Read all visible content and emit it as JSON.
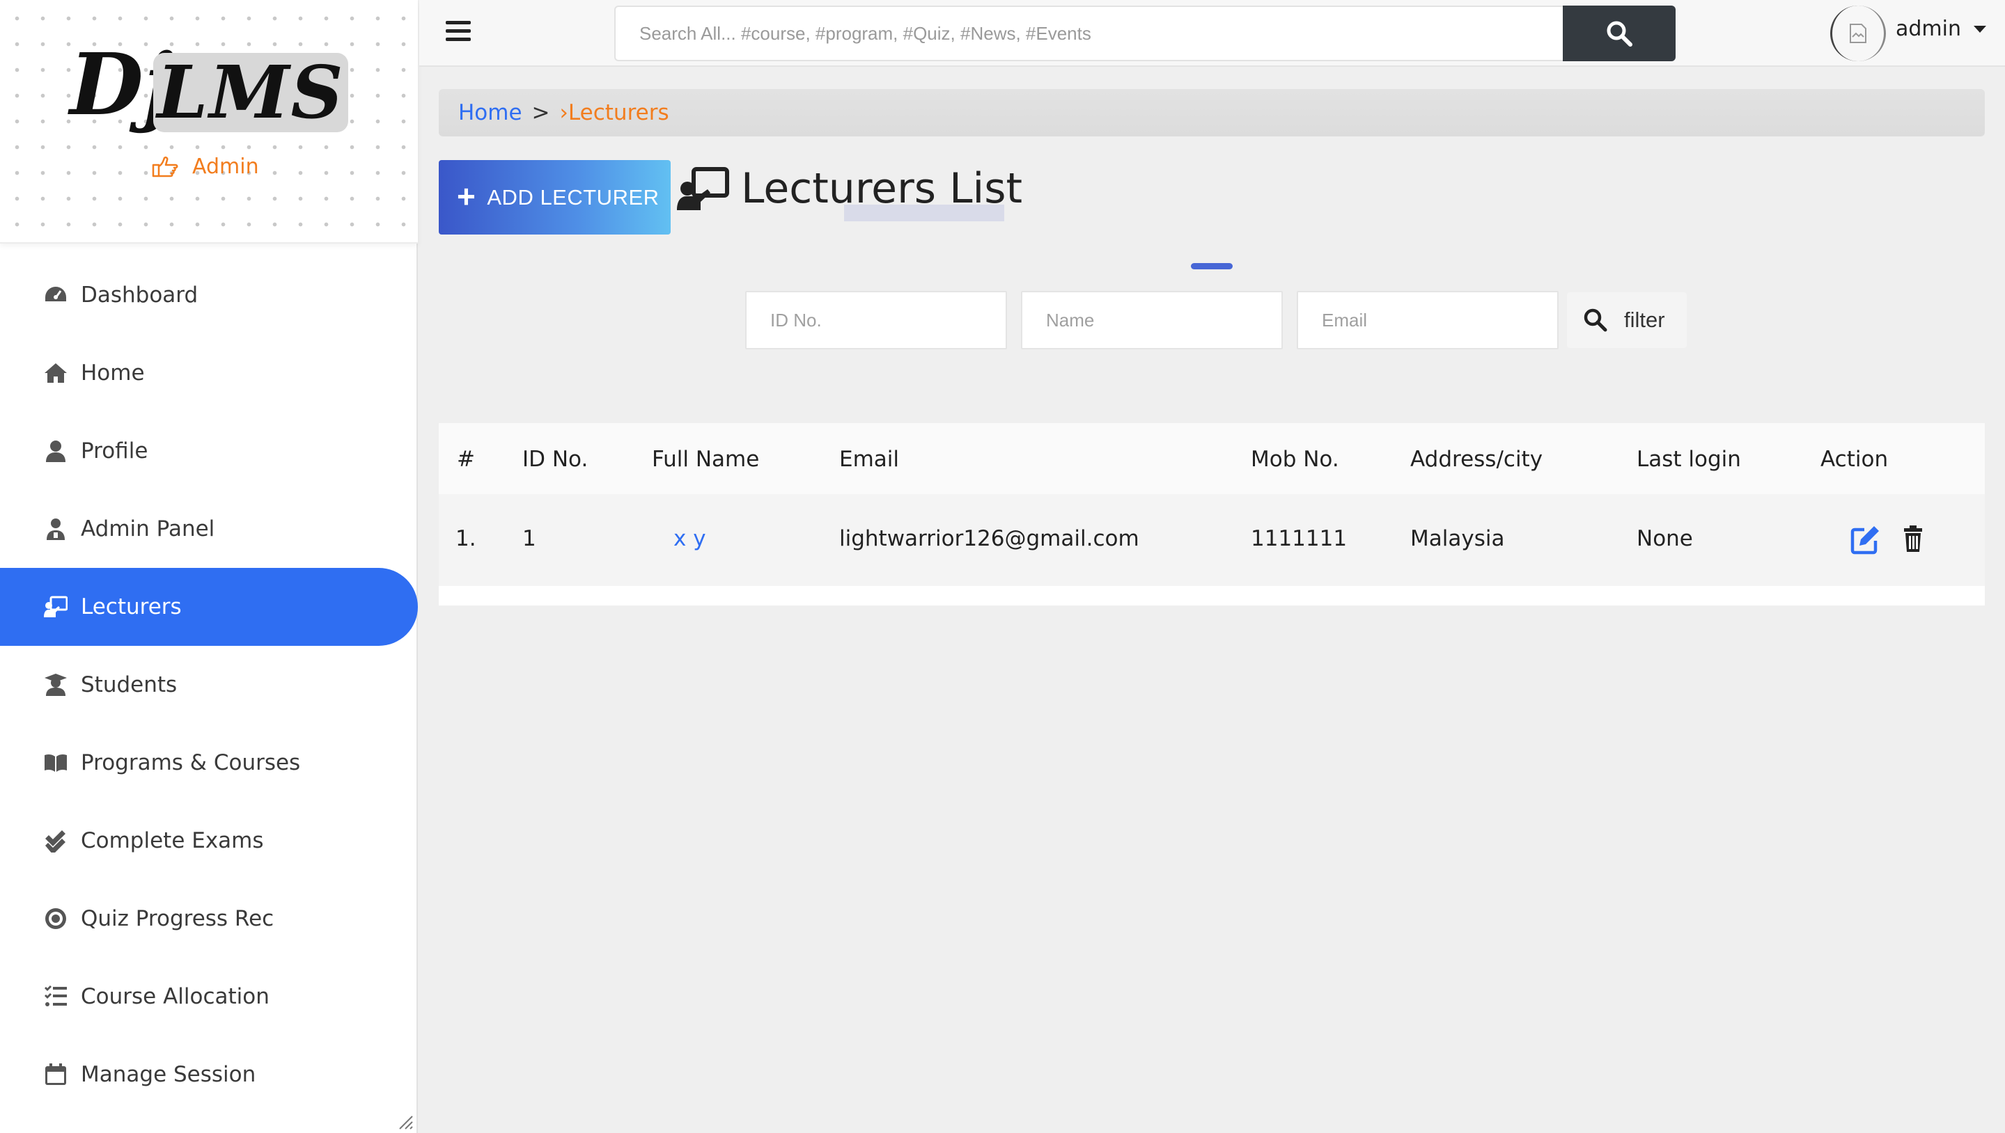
{
  "brand": {
    "logo_part1": "Dj",
    "logo_part2": "LMS",
    "role_label": "Admin"
  },
  "sidebar": {
    "items": [
      {
        "label": "Dashboard",
        "icon": "dashboard-icon",
        "active": false
      },
      {
        "label": "Home",
        "icon": "home-icon",
        "active": false
      },
      {
        "label": "Profile",
        "icon": "user-icon",
        "active": false
      },
      {
        "label": "Admin Panel",
        "icon": "user-shield-icon",
        "active": false
      },
      {
        "label": "Lecturers",
        "icon": "chalkboard-teacher-icon",
        "active": true
      },
      {
        "label": "Students",
        "icon": "user-graduate-icon",
        "active": false
      },
      {
        "label": "Programs & Courses",
        "icon": "book-icon",
        "active": false
      },
      {
        "label": "Complete Exams",
        "icon": "check-double-icon",
        "active": false
      },
      {
        "label": "Quiz Progress Rec",
        "icon": "record-icon",
        "active": false
      },
      {
        "label": "Course Allocation",
        "icon": "tasks-icon",
        "active": false
      },
      {
        "label": "Manage Session",
        "icon": "calendar-icon",
        "active": false
      }
    ]
  },
  "topbar": {
    "search_placeholder": "Search All... #course, #program, #Quiz, #News, #Events",
    "search_value": "",
    "username": "admin"
  },
  "breadcrumb": {
    "home": "Home",
    "separator": ">",
    "current": "›Lecturers"
  },
  "main": {
    "add_button_label": "ADD LECTURER",
    "page_title": "Lecturers List",
    "filters": {
      "id_placeholder": "ID No.",
      "name_placeholder": "Name",
      "email_placeholder": "Email",
      "filter_button_label": "filter"
    }
  },
  "table": {
    "headers": [
      "#",
      "ID No.",
      "Full Name",
      "Email",
      "Mob No.",
      "Address/city",
      "Last login",
      "Action"
    ],
    "rows": [
      {
        "num": "1.",
        "id": "1",
        "full_name": "x y",
        "email": "lightwarrior126@gmail.com",
        "mob": "1111111",
        "address": "Malaysia",
        "last_login": "None"
      }
    ]
  },
  "colors": {
    "accent": "#2f6ef2",
    "orange": "#f27d1e",
    "dark_button": "#343a40",
    "edit_icon": "#2f6ef2"
  }
}
